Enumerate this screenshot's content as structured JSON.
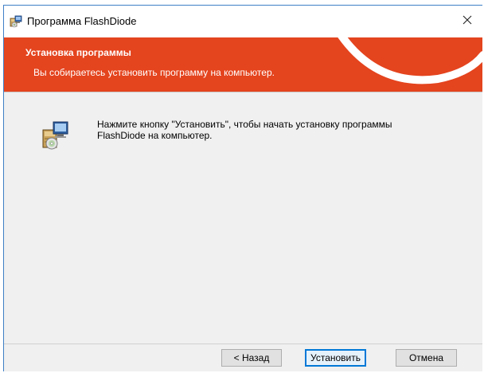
{
  "window": {
    "title": "Программа FlashDiode",
    "close_glyph": "✕"
  },
  "banner": {
    "title": "Установка программы",
    "subtitle": "Вы собираетесь установить программу на компьютер.",
    "color": "#e4441e"
  },
  "content": {
    "line1": "Нажмите кнопку \"Установить\", чтобы начать установку программы",
    "line2": "FlashDiode на компьютер."
  },
  "buttons": {
    "back": "< Назад",
    "install": "Установить",
    "cancel": "Отмена"
  }
}
